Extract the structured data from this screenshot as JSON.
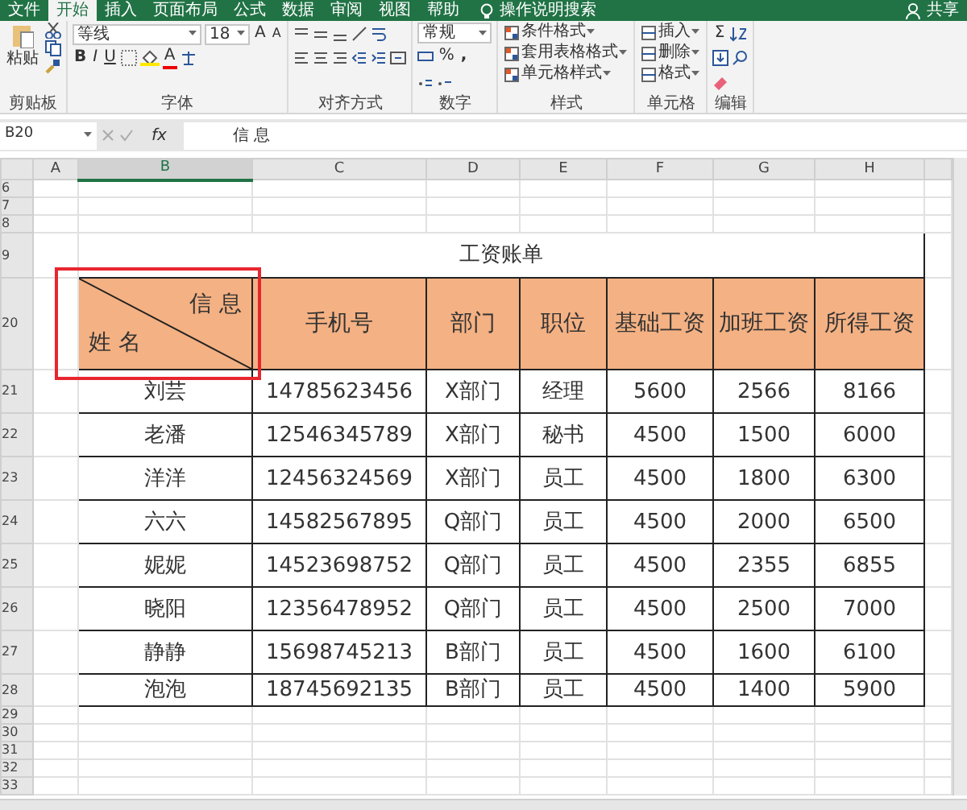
{
  "ribbon_tabs": [
    {
      "label": "文件",
      "selected": false
    },
    {
      "label": "开始",
      "selected": true
    },
    {
      "label": "插入",
      "selected": false
    },
    {
      "label": "页面布局",
      "selected": false
    },
    {
      "label": "公式",
      "selected": false
    },
    {
      "label": "数据",
      "selected": false
    },
    {
      "label": "审阅",
      "selected": false
    },
    {
      "label": "视图",
      "selected": false
    },
    {
      "label": "帮助",
      "selected": false
    }
  ],
  "search_hint": "操作说明搜索",
  "share": "共享",
  "clipboard": {
    "paste": "粘贴",
    "label": "剪贴板"
  },
  "font": {
    "name": "等线",
    "size": "18",
    "grow": "A",
    "shrink": "A",
    "buttons": [
      "B",
      "I",
      "U"
    ],
    "color_button": "A",
    "label": "字体"
  },
  "alignment": {
    "label": "对齐方式"
  },
  "number": {
    "format": "常规",
    "percent": "%",
    "comma": ",",
    "label": "数字"
  },
  "styles": {
    "items": [
      "条件格式",
      "套用表格格式",
      "单元格样式"
    ],
    "label": "样式"
  },
  "cells": {
    "items": [
      "插入",
      "删除",
      "格式"
    ],
    "label": "单元格"
  },
  "editing": {
    "sum": "Σ",
    "label": "编辑"
  },
  "formula_bar": {
    "name_box": "B20",
    "fx": "fx",
    "value": "信 息"
  },
  "column_letters": [
    {
      "label": "A",
      "selected": false
    },
    {
      "label": "B",
      "selected": true
    },
    {
      "label": "C",
      "selected": false
    },
    {
      "label": "D",
      "selected": false
    },
    {
      "label": "E",
      "selected": false
    },
    {
      "label": "F",
      "selected": false
    },
    {
      "label": "G",
      "selected": false
    },
    {
      "label": "H",
      "selected": false
    }
  ],
  "row_numbers": [
    "6",
    "7",
    "8",
    "9",
    "20",
    "21",
    "22",
    "23",
    "24",
    "25",
    "26",
    "27",
    "28",
    "29",
    "30",
    "31",
    "32",
    "33"
  ],
  "table": {
    "title": "工资账单",
    "header_cells": [
      {
        "kind": "diagonal",
        "top": "信 息",
        "bottom": "姓 名"
      },
      {
        "kind": "text",
        "label": "手机号"
      },
      {
        "kind": "text",
        "label": "部门"
      },
      {
        "kind": "text",
        "label": "职位"
      },
      {
        "kind": "text",
        "label": "基础工资"
      },
      {
        "kind": "text",
        "label": "加班工资"
      },
      {
        "kind": "text",
        "label": "所得工资"
      }
    ],
    "rows": [
      [
        "刘芸",
        "14785623456",
        "X部门",
        "经理",
        "5600",
        "2566",
        "8166"
      ],
      [
        "老潘",
        "12546345789",
        "X部门",
        "秘书",
        "4500",
        "1500",
        "6000"
      ],
      [
        "洋洋",
        "12456324569",
        "X部门",
        "员工",
        "4500",
        "1800",
        "6300"
      ],
      [
        "六六",
        "14582567895",
        "Q部门",
        "员工",
        "4500",
        "2000",
        "6500"
      ],
      [
        "妮妮",
        "14523698752",
        "Q部门",
        "员工",
        "4500",
        "2355",
        "6855"
      ],
      [
        "晓阳",
        "12356478952",
        "Q部门",
        "员工",
        "4500",
        "2500",
        "7000"
      ],
      [
        "静静",
        "15698745213",
        "B部门",
        "员工",
        "4500",
        "1600",
        "6100"
      ],
      [
        "泡泡",
        "18745692135",
        "B部门",
        "员工",
        "4500",
        "1400",
        "5900"
      ]
    ]
  }
}
